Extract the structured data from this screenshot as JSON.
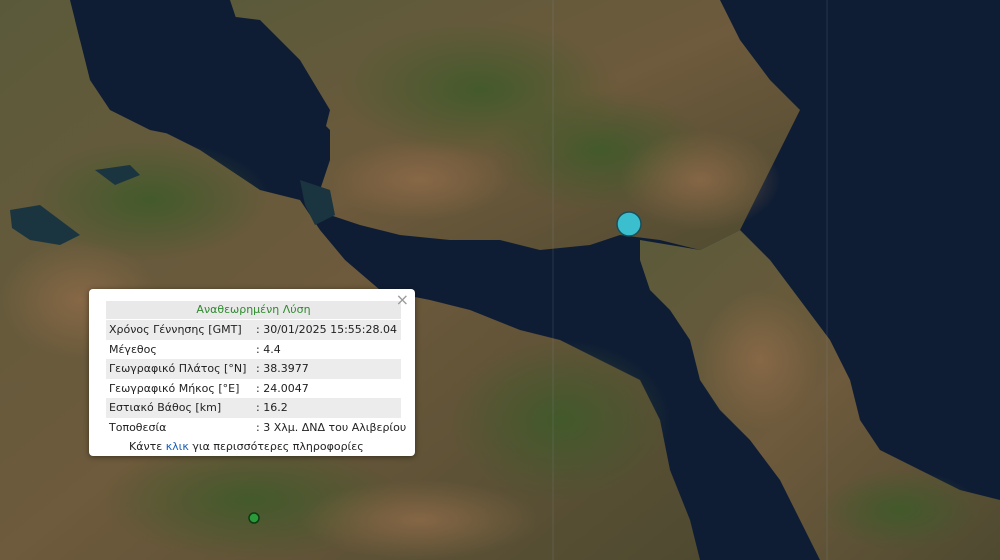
{
  "popup": {
    "title": "Αναθεωρημένη Λύση",
    "close_symbol": "×",
    "rows": [
      {
        "label": "Χρόνος Γέννησης [GMT]",
        "value": ": 30/01/2025 15:55:28.04"
      },
      {
        "label": "Μέγεθος",
        "value": ": 4.4"
      },
      {
        "label": "Γεωγραφικό Πλάτος [°N]",
        "value": ": 38.3977"
      },
      {
        "label": "Γεωγραφικό Μήκος [°E]",
        "value": ": 24.0047"
      },
      {
        "label": "Εστιακό Βάθος [km]",
        "value": ": 16.2"
      },
      {
        "label": "Τοποθεσία",
        "value": ": 3 Χλμ. ΔΝΔ του Αλιβερίου"
      }
    ],
    "more_prefix": "Κάντε ",
    "more_link": "κλικ",
    "more_suffix": " για περισσότερες πληροφορίες"
  },
  "markers": {
    "earthquake_color": "#3bbfcf",
    "station_color": "#2a9a3a"
  },
  "colors": {
    "sea": "#0e1c33",
    "land_dark": "#3d4a2a",
    "land_light": "#7a5e3e"
  }
}
